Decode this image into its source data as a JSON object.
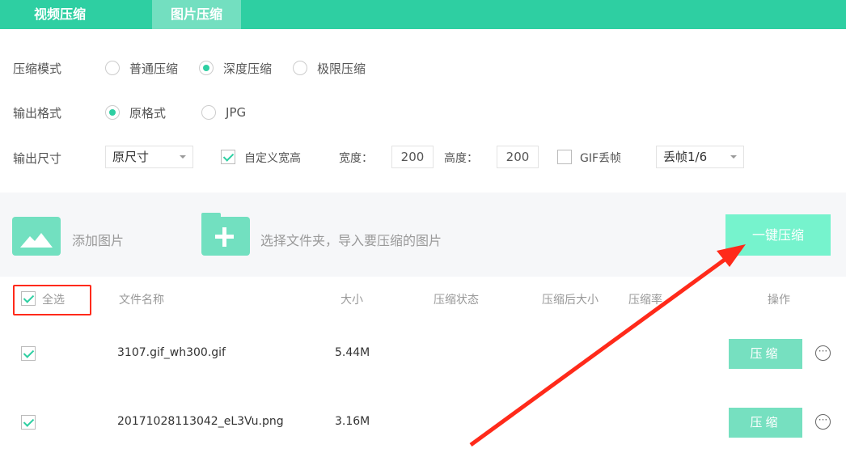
{
  "tabs": [
    {
      "label": "视频压缩",
      "active": false
    },
    {
      "label": "图片压缩",
      "active": true
    }
  ],
  "settings": {
    "mode": {
      "label": "压缩模式",
      "options": [
        "普通压缩",
        "深度压缩",
        "极限压缩"
      ],
      "selected": "深度压缩"
    },
    "format": {
      "label": "输出格式",
      "options": [
        "原格式",
        "JPG"
      ],
      "selected": "原格式"
    },
    "size": {
      "label": "输出尺寸",
      "select_value": "原尺寸",
      "custom_label": "自定义宽高",
      "custom_checked": true,
      "width_label": "宽度：",
      "width_value": "200",
      "height_label": "高度：",
      "height_value": "200",
      "gif_label": "GIF丢帧",
      "gif_checked": false,
      "gif_select": "丢帧1/6"
    }
  },
  "toolbar": {
    "add_image": "添加图片",
    "add_folder": "选择文件夹，导入要压缩的图片",
    "compress_all": "一键压缩"
  },
  "table": {
    "select_all": "全选",
    "select_all_checked": true,
    "headers": [
      "文件名称",
      "大小",
      "压缩状态",
      "压缩后大小",
      "压缩率",
      "操作"
    ],
    "rows": [
      {
        "checked": true,
        "name": "3107.gif_wh300.gif",
        "size": "5.44M",
        "action": "压缩"
      },
      {
        "checked": true,
        "name": "20171028113042_eL3Vu.png",
        "size": "3.16M",
        "action": "压缩"
      }
    ]
  },
  "colors": {
    "accent": "#2ecfa2",
    "annotation": "#ff2a1a"
  }
}
